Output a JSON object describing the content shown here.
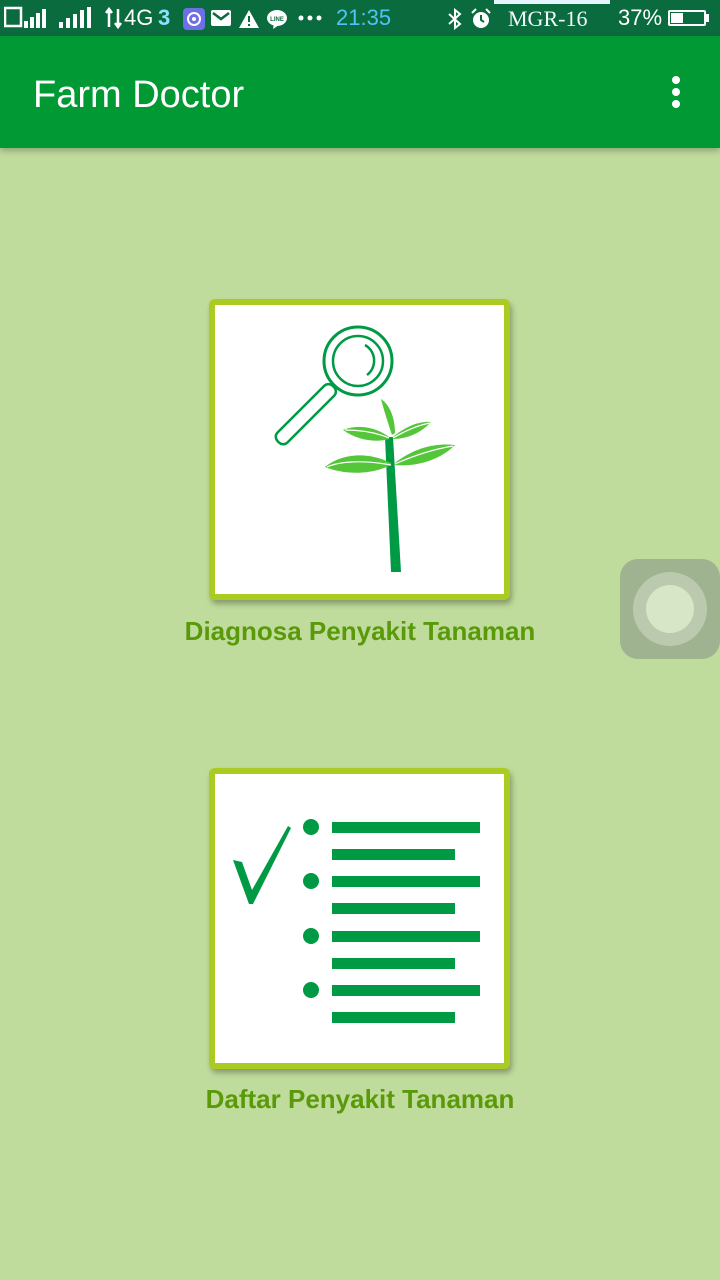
{
  "status_bar": {
    "network": "4G",
    "carrier_mark": "3",
    "time": "21:35",
    "operator": "MGR-16",
    "battery": "37%",
    "battery_level": 0.37,
    "icons": [
      "sim-signal-icon",
      "signal-icon",
      "data-arrows-icon",
      "three-logo-icon",
      "browser-icon",
      "gmail-icon",
      "warning-icon",
      "line-icon",
      "more-notifications-icon",
      "bluetooth-icon",
      "alarm-icon",
      "battery-icon"
    ]
  },
  "app_bar": {
    "title": "Farm Doctor",
    "menu_icon": "overflow-menu-icon"
  },
  "menu": {
    "items": [
      {
        "label": "Diagnosa Penyakit Tanaman",
        "icon": "magnifier-plant-icon"
      },
      {
        "label": "Daftar Penyakit Tanaman",
        "icon": "checklist-icon"
      }
    ]
  },
  "colors": {
    "background": "#c0dc9c",
    "app_bar": "#009933",
    "status_bar": "#0a6b3e",
    "card_border": "#aacc22",
    "label": "#5a9a0a",
    "icon_green": "#009944",
    "leaf_green": "#55c63a"
  }
}
